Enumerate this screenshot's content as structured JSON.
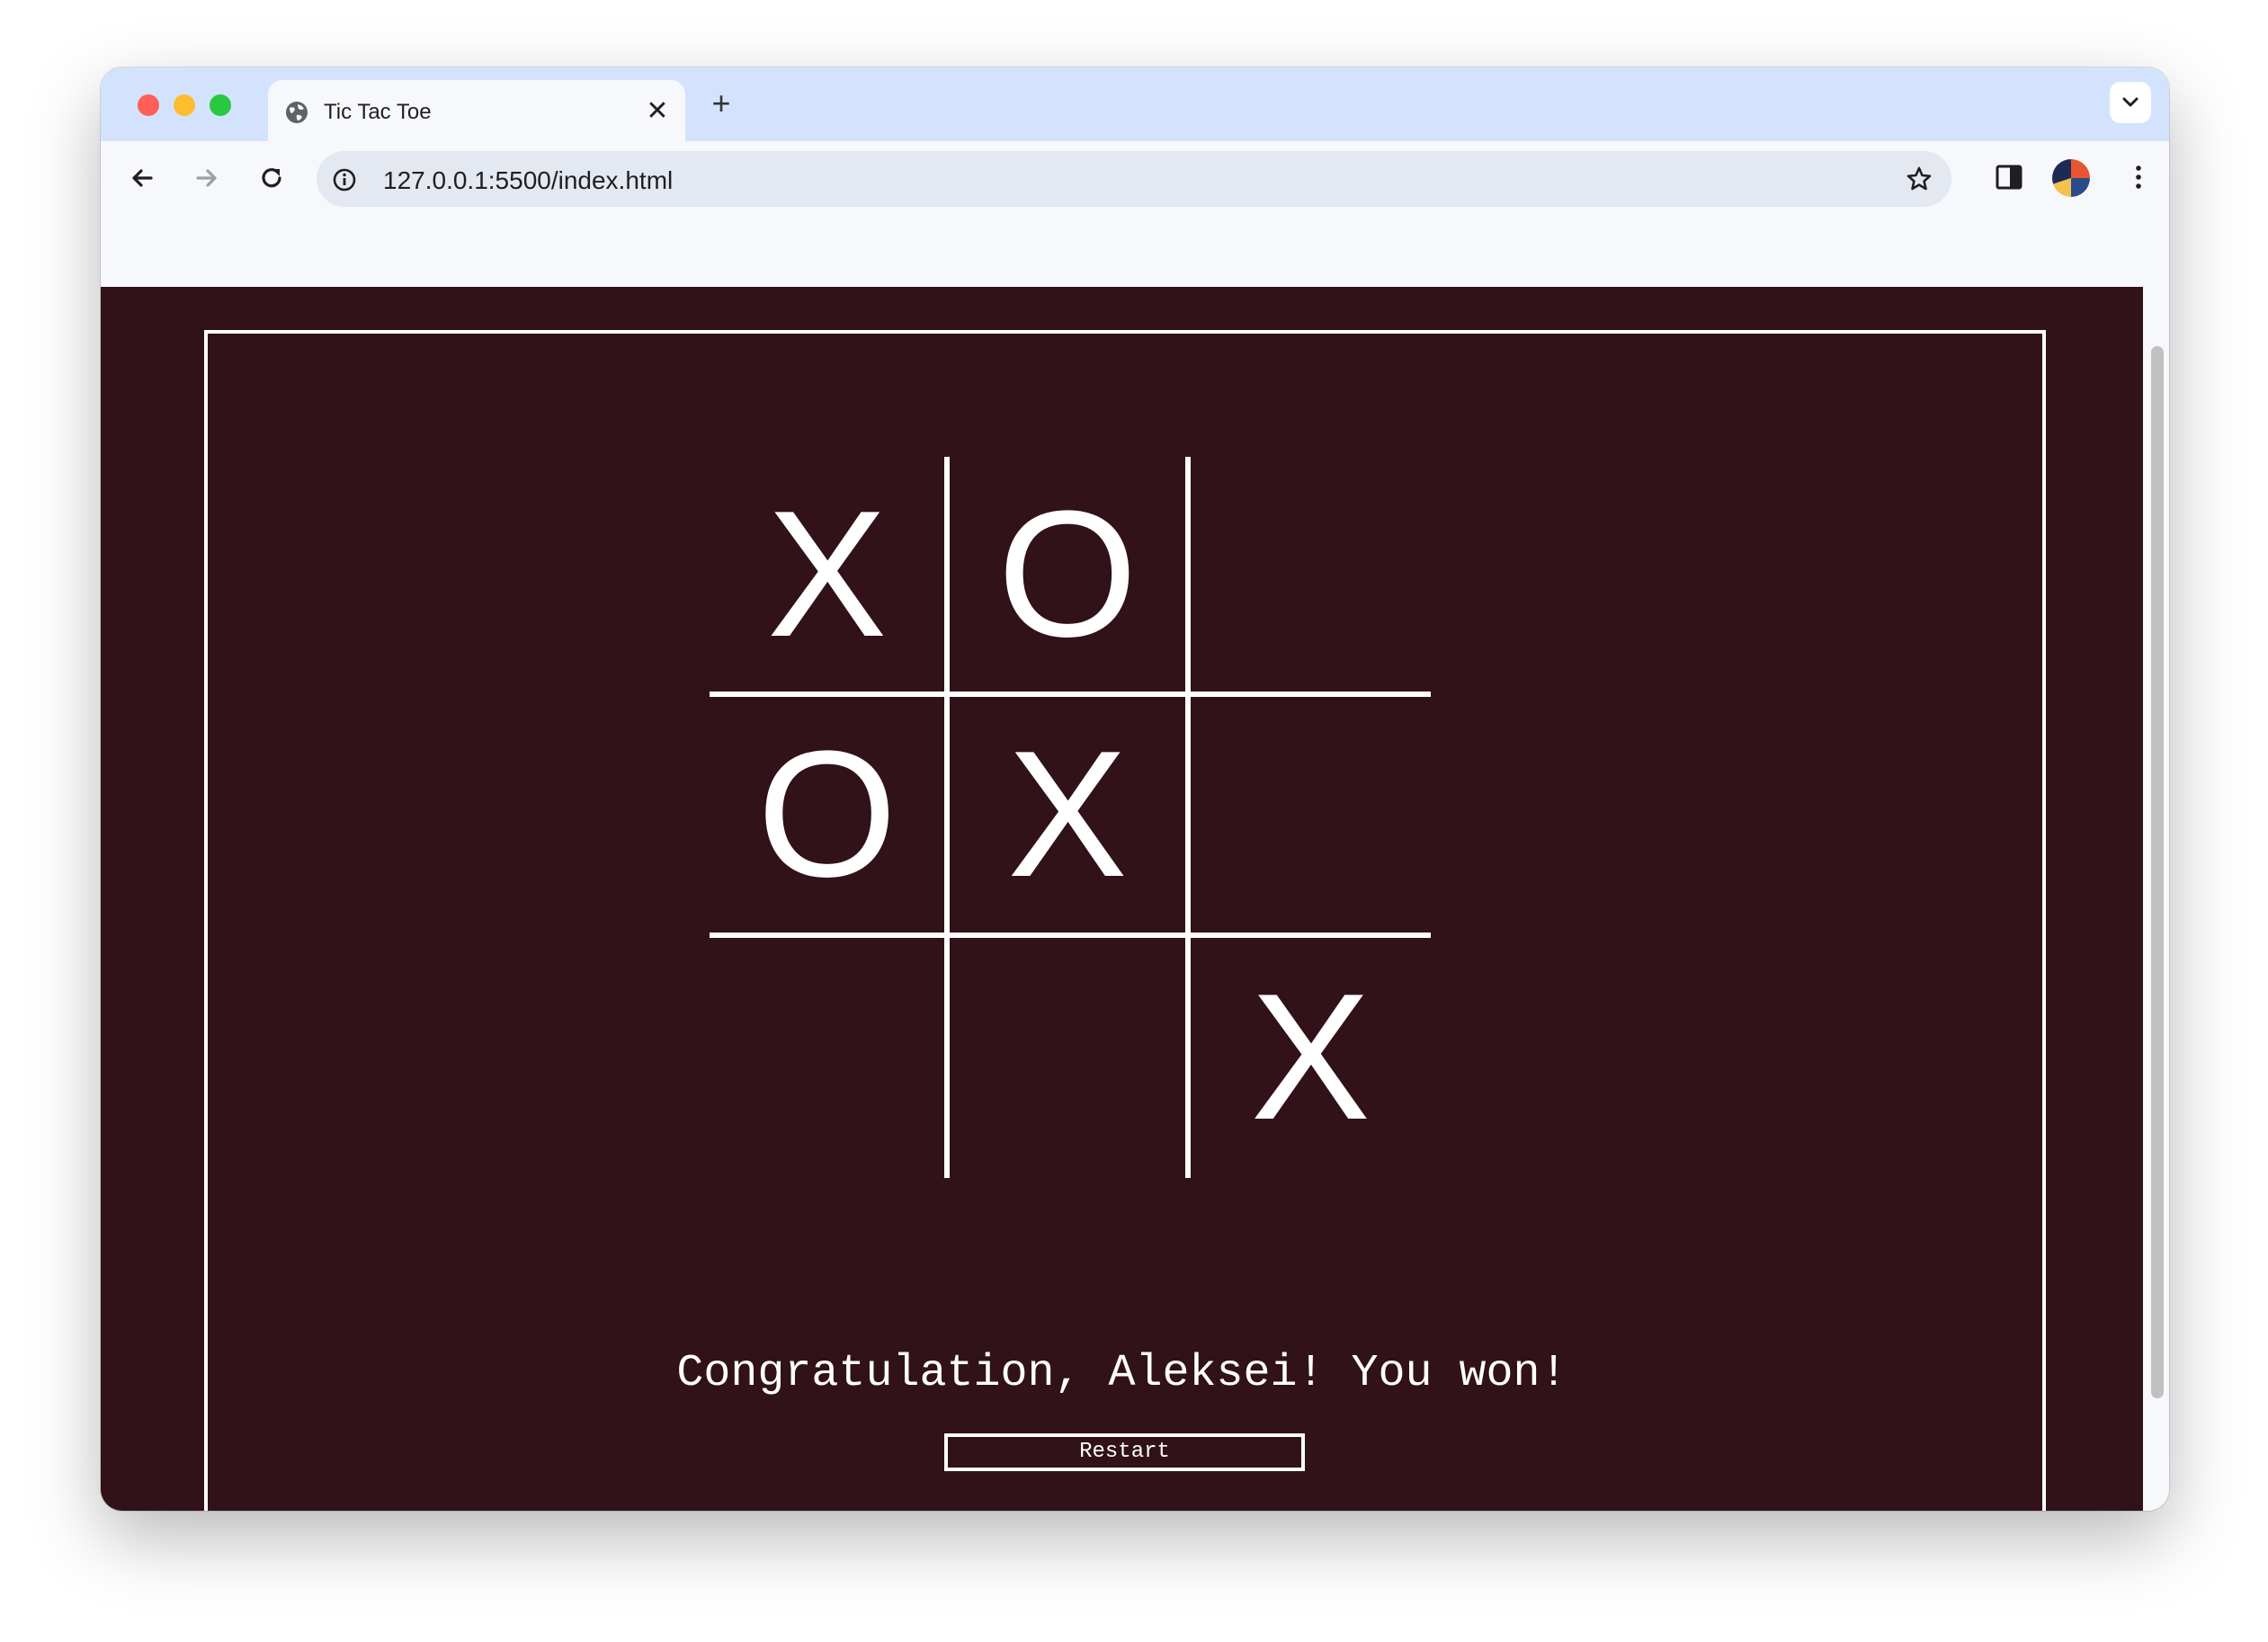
{
  "browser": {
    "tab_title": "Tic Tac Toe",
    "tab_close": "✕",
    "new_tab": "+",
    "url": "127.0.0.1:5500/index.html"
  },
  "game": {
    "board": [
      "X",
      "O",
      "",
      "O",
      "X",
      "",
      "",
      "",
      "X"
    ],
    "message": "Congratulation, Aleksei! You won!",
    "restart_label": "Restart"
  },
  "colors": {
    "page_background": "#311218",
    "foreground": "#ffffff",
    "tabstrip": "#d3e3fd"
  }
}
